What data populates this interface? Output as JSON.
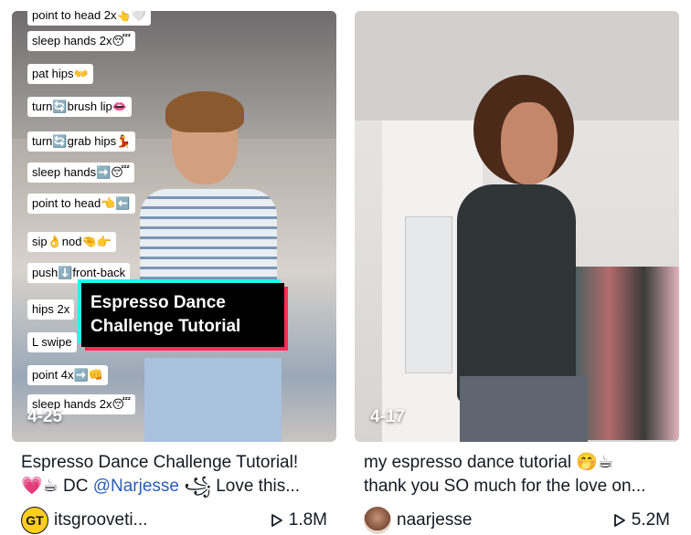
{
  "videos": [
    {
      "date": "4-25",
      "steps": [
        "point to head 2x👆🤍",
        "sleep hands 2x😴",
        "pat hips👐",
        "turn🔄brush lip👄",
        "turn🔄grab hips💃",
        "sleep hands➡️😴",
        "point to head👈⬅️",
        "sip👌nod🤏👉",
        "push⬇️front-back",
        "hips 2x",
        "L swipe",
        "point 4x➡️👊",
        "sleep hands 2x😴"
      ],
      "overlay_title": "Espresso Dance Challenge Tutorial",
      "description_line1": "Espresso Dance Challenge Tutorial!",
      "description_line2_prefix": "💗☕ DC ",
      "description_mention": "@Narjesse",
      "description_line2_suffix": " ꧁ Love this...",
      "avatar_text": "GT",
      "username": "itsgrooveti...",
      "views": "1.8M"
    },
    {
      "date": "4-17",
      "description_line1": "my espresso dance tutorial 🤭☕",
      "description_line2": "thank you SO much for the love on...",
      "username": "naarjesse",
      "views": "5.2M"
    }
  ],
  "icons": {
    "play": "play-icon"
  }
}
